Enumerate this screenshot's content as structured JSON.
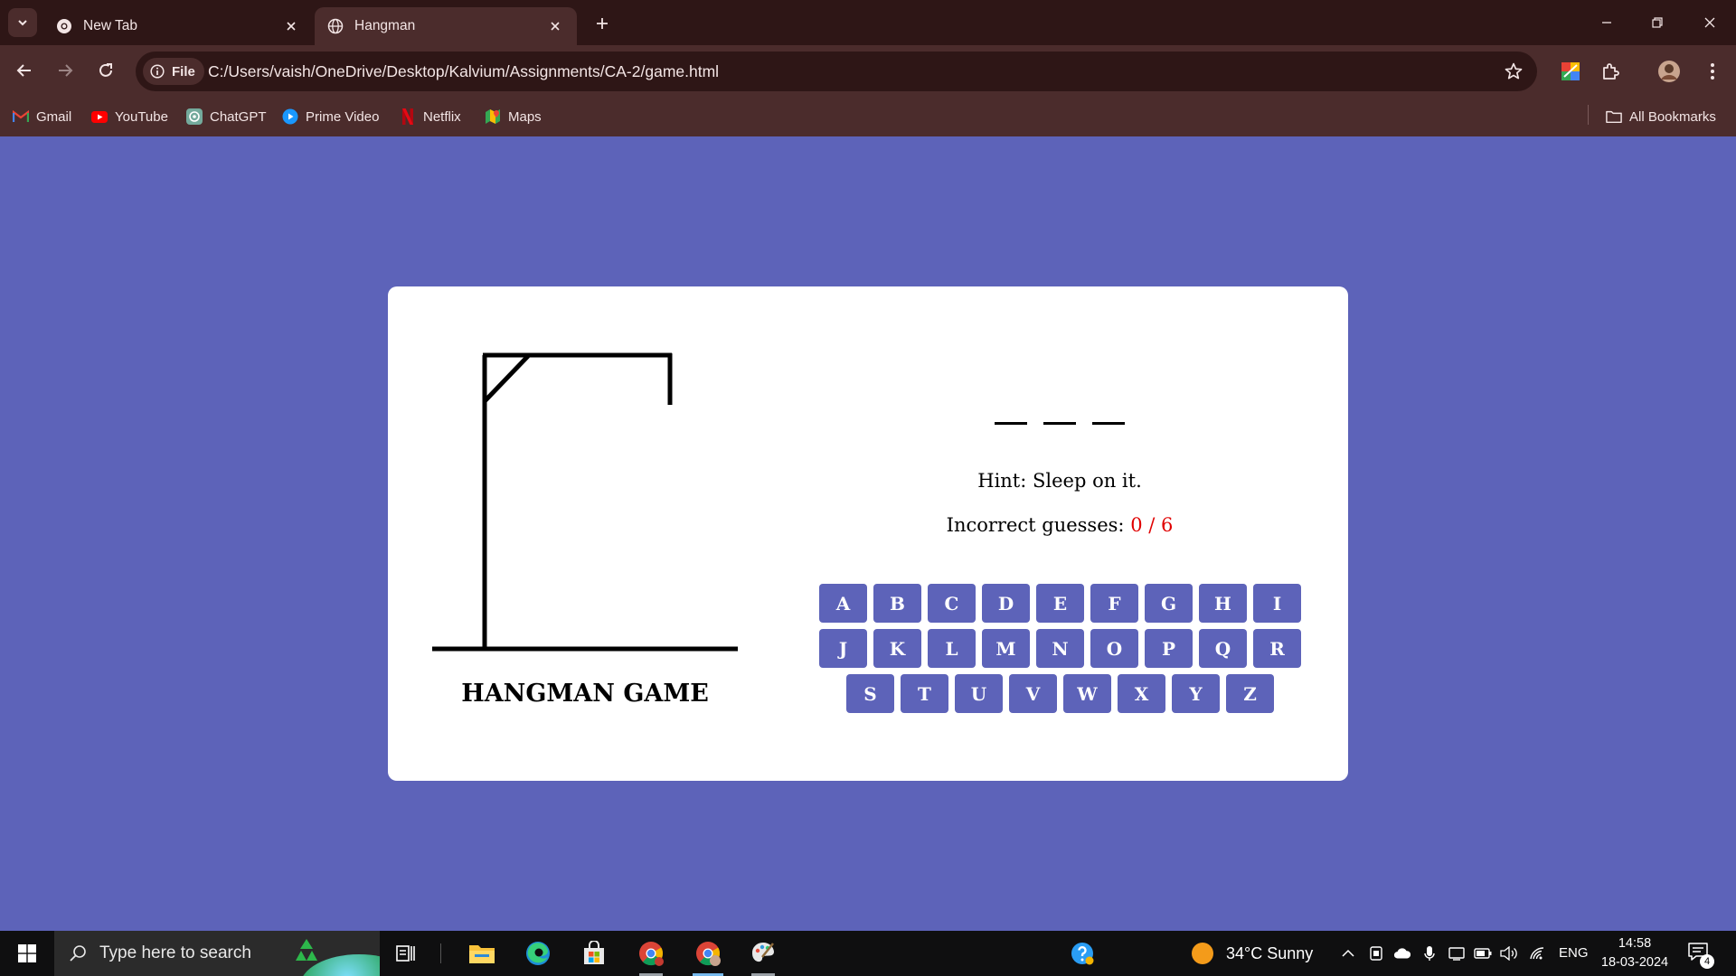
{
  "browser": {
    "tabs": [
      {
        "title": "New Tab",
        "active": false
      },
      {
        "title": "Hangman",
        "active": true
      }
    ],
    "address_chip": "File",
    "url": "C:/Users/vaish/OneDrive/Desktop/Kalvium/Assignments/CA-2/game.html",
    "bookmarks": [
      {
        "label": "Gmail",
        "icon": "gmail-icon"
      },
      {
        "label": "YouTube",
        "icon": "youtube-icon"
      },
      {
        "label": "ChatGPT",
        "icon": "chatgpt-icon"
      },
      {
        "label": "Prime Video",
        "icon": "prime-video-icon"
      },
      {
        "label": "Netflix",
        "icon": "netflix-icon"
      },
      {
        "label": "Maps",
        "icon": "maps-icon"
      }
    ],
    "all_bookmarks_label": "All Bookmarks",
    "colors": {
      "frame": "#2e1616",
      "toolbar": "#4b2c2c"
    }
  },
  "game": {
    "title": "HANGMAN GAME",
    "word_slots": 3,
    "hint_label": "Hint: Sleep on it.",
    "guesses_label": "Incorrect guesses:",
    "guesses_count": "0 / 6",
    "keyboard_rows": [
      [
        "A",
        "B",
        "C",
        "D",
        "E",
        "F",
        "G",
        "H",
        "I"
      ],
      [
        "J",
        "K",
        "L",
        "M",
        "N",
        "O",
        "P",
        "Q",
        "R"
      ],
      [
        "S",
        "T",
        "U",
        "V",
        "W",
        "X",
        "Y",
        "Z"
      ]
    ],
    "colors": {
      "page_bg": "#5d63b9",
      "key_bg": "#5d63b9",
      "count": "#e00000"
    }
  },
  "taskbar": {
    "search_placeholder": "Type here to search",
    "weather": "34°C  Sunny",
    "language": "ENG",
    "time": "14:58",
    "date": "18-03-2024",
    "notification_count": "4"
  }
}
